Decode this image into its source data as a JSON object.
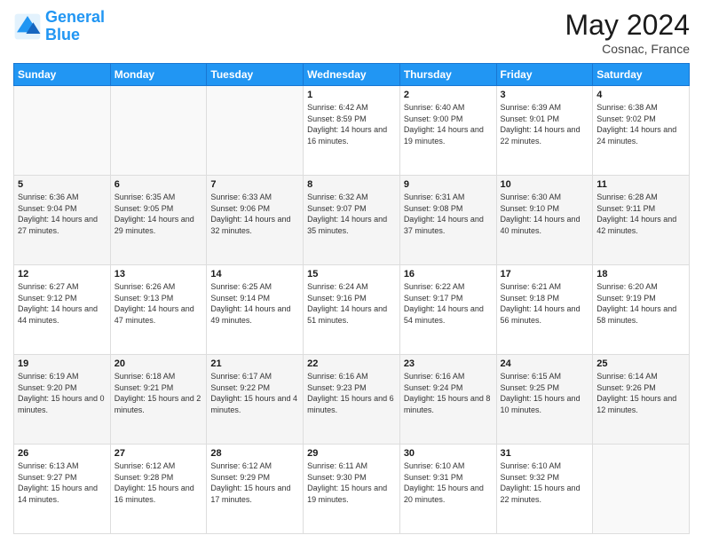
{
  "header": {
    "logo_line1": "General",
    "logo_line2": "Blue",
    "month": "May 2024",
    "location": "Cosnac, France"
  },
  "days_of_week": [
    "Sunday",
    "Monday",
    "Tuesday",
    "Wednesday",
    "Thursday",
    "Friday",
    "Saturday"
  ],
  "weeks": [
    [
      {
        "day": "",
        "sunrise": "",
        "sunset": "",
        "daylight": ""
      },
      {
        "day": "",
        "sunrise": "",
        "sunset": "",
        "daylight": ""
      },
      {
        "day": "",
        "sunrise": "",
        "sunset": "",
        "daylight": ""
      },
      {
        "day": "1",
        "sunrise": "Sunrise: 6:42 AM",
        "sunset": "Sunset: 8:59 PM",
        "daylight": "Daylight: 14 hours and 16 minutes."
      },
      {
        "day": "2",
        "sunrise": "Sunrise: 6:40 AM",
        "sunset": "Sunset: 9:00 PM",
        "daylight": "Daylight: 14 hours and 19 minutes."
      },
      {
        "day": "3",
        "sunrise": "Sunrise: 6:39 AM",
        "sunset": "Sunset: 9:01 PM",
        "daylight": "Daylight: 14 hours and 22 minutes."
      },
      {
        "day": "4",
        "sunrise": "Sunrise: 6:38 AM",
        "sunset": "Sunset: 9:02 PM",
        "daylight": "Daylight: 14 hours and 24 minutes."
      }
    ],
    [
      {
        "day": "5",
        "sunrise": "Sunrise: 6:36 AM",
        "sunset": "Sunset: 9:04 PM",
        "daylight": "Daylight: 14 hours and 27 minutes."
      },
      {
        "day": "6",
        "sunrise": "Sunrise: 6:35 AM",
        "sunset": "Sunset: 9:05 PM",
        "daylight": "Daylight: 14 hours and 29 minutes."
      },
      {
        "day": "7",
        "sunrise": "Sunrise: 6:33 AM",
        "sunset": "Sunset: 9:06 PM",
        "daylight": "Daylight: 14 hours and 32 minutes."
      },
      {
        "day": "8",
        "sunrise": "Sunrise: 6:32 AM",
        "sunset": "Sunset: 9:07 PM",
        "daylight": "Daylight: 14 hours and 35 minutes."
      },
      {
        "day": "9",
        "sunrise": "Sunrise: 6:31 AM",
        "sunset": "Sunset: 9:08 PM",
        "daylight": "Daylight: 14 hours and 37 minutes."
      },
      {
        "day": "10",
        "sunrise": "Sunrise: 6:30 AM",
        "sunset": "Sunset: 9:10 PM",
        "daylight": "Daylight: 14 hours and 40 minutes."
      },
      {
        "day": "11",
        "sunrise": "Sunrise: 6:28 AM",
        "sunset": "Sunset: 9:11 PM",
        "daylight": "Daylight: 14 hours and 42 minutes."
      }
    ],
    [
      {
        "day": "12",
        "sunrise": "Sunrise: 6:27 AM",
        "sunset": "Sunset: 9:12 PM",
        "daylight": "Daylight: 14 hours and 44 minutes."
      },
      {
        "day": "13",
        "sunrise": "Sunrise: 6:26 AM",
        "sunset": "Sunset: 9:13 PM",
        "daylight": "Daylight: 14 hours and 47 minutes."
      },
      {
        "day": "14",
        "sunrise": "Sunrise: 6:25 AM",
        "sunset": "Sunset: 9:14 PM",
        "daylight": "Daylight: 14 hours and 49 minutes."
      },
      {
        "day": "15",
        "sunrise": "Sunrise: 6:24 AM",
        "sunset": "Sunset: 9:16 PM",
        "daylight": "Daylight: 14 hours and 51 minutes."
      },
      {
        "day": "16",
        "sunrise": "Sunrise: 6:22 AM",
        "sunset": "Sunset: 9:17 PM",
        "daylight": "Daylight: 14 hours and 54 minutes."
      },
      {
        "day": "17",
        "sunrise": "Sunrise: 6:21 AM",
        "sunset": "Sunset: 9:18 PM",
        "daylight": "Daylight: 14 hours and 56 minutes."
      },
      {
        "day": "18",
        "sunrise": "Sunrise: 6:20 AM",
        "sunset": "Sunset: 9:19 PM",
        "daylight": "Daylight: 14 hours and 58 minutes."
      }
    ],
    [
      {
        "day": "19",
        "sunrise": "Sunrise: 6:19 AM",
        "sunset": "Sunset: 9:20 PM",
        "daylight": "Daylight: 15 hours and 0 minutes."
      },
      {
        "day": "20",
        "sunrise": "Sunrise: 6:18 AM",
        "sunset": "Sunset: 9:21 PM",
        "daylight": "Daylight: 15 hours and 2 minutes."
      },
      {
        "day": "21",
        "sunrise": "Sunrise: 6:17 AM",
        "sunset": "Sunset: 9:22 PM",
        "daylight": "Daylight: 15 hours and 4 minutes."
      },
      {
        "day": "22",
        "sunrise": "Sunrise: 6:16 AM",
        "sunset": "Sunset: 9:23 PM",
        "daylight": "Daylight: 15 hours and 6 minutes."
      },
      {
        "day": "23",
        "sunrise": "Sunrise: 6:16 AM",
        "sunset": "Sunset: 9:24 PM",
        "daylight": "Daylight: 15 hours and 8 minutes."
      },
      {
        "day": "24",
        "sunrise": "Sunrise: 6:15 AM",
        "sunset": "Sunset: 9:25 PM",
        "daylight": "Daylight: 15 hours and 10 minutes."
      },
      {
        "day": "25",
        "sunrise": "Sunrise: 6:14 AM",
        "sunset": "Sunset: 9:26 PM",
        "daylight": "Daylight: 15 hours and 12 minutes."
      }
    ],
    [
      {
        "day": "26",
        "sunrise": "Sunrise: 6:13 AM",
        "sunset": "Sunset: 9:27 PM",
        "daylight": "Daylight: 15 hours and 14 minutes."
      },
      {
        "day": "27",
        "sunrise": "Sunrise: 6:12 AM",
        "sunset": "Sunset: 9:28 PM",
        "daylight": "Daylight: 15 hours and 16 minutes."
      },
      {
        "day": "28",
        "sunrise": "Sunrise: 6:12 AM",
        "sunset": "Sunset: 9:29 PM",
        "daylight": "Daylight: 15 hours and 17 minutes."
      },
      {
        "day": "29",
        "sunrise": "Sunrise: 6:11 AM",
        "sunset": "Sunset: 9:30 PM",
        "daylight": "Daylight: 15 hours and 19 minutes."
      },
      {
        "day": "30",
        "sunrise": "Sunrise: 6:10 AM",
        "sunset": "Sunset: 9:31 PM",
        "daylight": "Daylight: 15 hours and 20 minutes."
      },
      {
        "day": "31",
        "sunrise": "Sunrise: 6:10 AM",
        "sunset": "Sunset: 9:32 PM",
        "daylight": "Daylight: 15 hours and 22 minutes."
      },
      {
        "day": "",
        "sunrise": "",
        "sunset": "",
        "daylight": ""
      }
    ]
  ]
}
